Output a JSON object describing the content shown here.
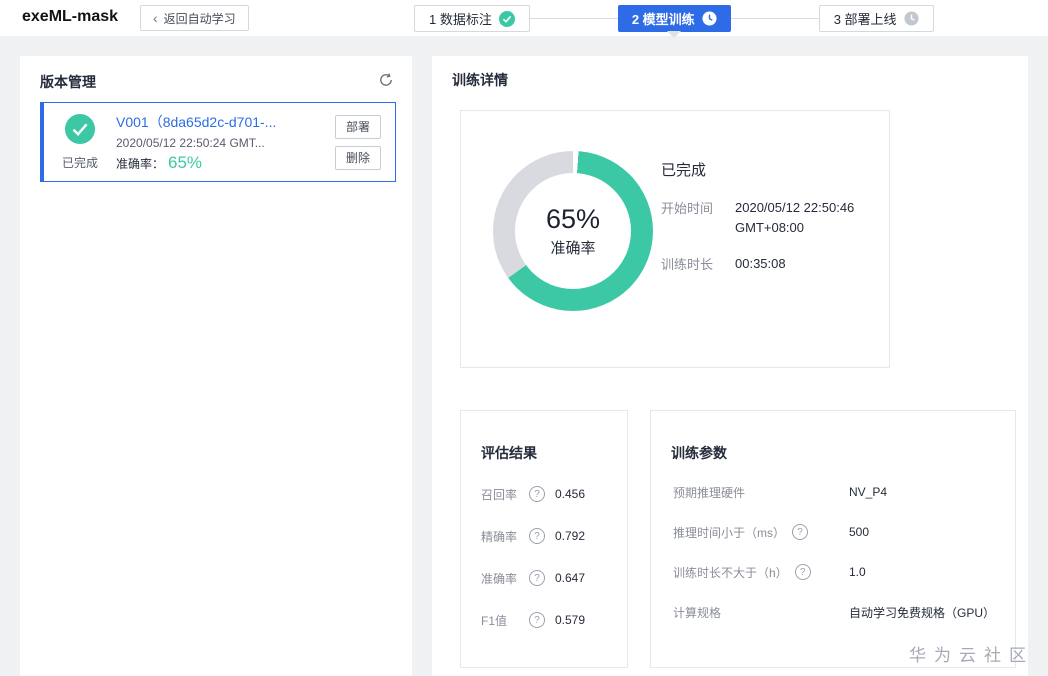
{
  "icons": {
    "help": "?",
    "chevron_left": "‹"
  },
  "colors": {
    "accent": "#2e6be6",
    "teal": "#3cc8a4",
    "ring": "#d8dadf"
  },
  "header": {
    "app_title": "exeML-mask",
    "back_button": "返回自动学习",
    "steps": [
      {
        "label": "1 数据标注",
        "status": "done"
      },
      {
        "label": "2 模型训练",
        "status": "active"
      },
      {
        "label": "3 部署上线",
        "status": "pending"
      }
    ]
  },
  "version_panel": {
    "title": "版本管理",
    "card": {
      "status_label": "已完成",
      "version_name": "V001",
      "version_id": "（8da65d2c-d701-...",
      "timestamp": "2020/05/12 22:50:24 GMT...",
      "accuracy_label": "准确率：",
      "accuracy_value": "65%",
      "deploy_button": "部署",
      "delete_button": "删除"
    }
  },
  "training_panel": {
    "title": "训练详情",
    "summary": {
      "status": "已完成",
      "donut": {
        "percent": 65,
        "value_label": "65%",
        "metric_label": "准确率"
      },
      "rows": [
        {
          "label": "开始时间",
          "value": "2020/05/12 22:50:46 GMT+08:00"
        },
        {
          "label": "训练时长",
          "value": "00:35:08"
        }
      ]
    },
    "evaluation": {
      "title": "评估结果",
      "rows": [
        {
          "label": "召回率",
          "value": "0.456"
        },
        {
          "label": "精确率",
          "value": "0.792"
        },
        {
          "label": "准确率",
          "value": "0.647"
        },
        {
          "label": "F1值",
          "value": "0.579"
        }
      ]
    },
    "parameters": {
      "title": "训练参数",
      "rows": [
        {
          "label": "预期推理硬件",
          "value": "NV_P4"
        },
        {
          "label": "推理时间小于（ms）",
          "value": "500"
        },
        {
          "label": "训练时长不大于（h）",
          "value": "1.0"
        },
        {
          "label": "计算规格",
          "value": "自动学习免费规格（GPU）"
        }
      ]
    }
  },
  "watermark": "华为云社区"
}
